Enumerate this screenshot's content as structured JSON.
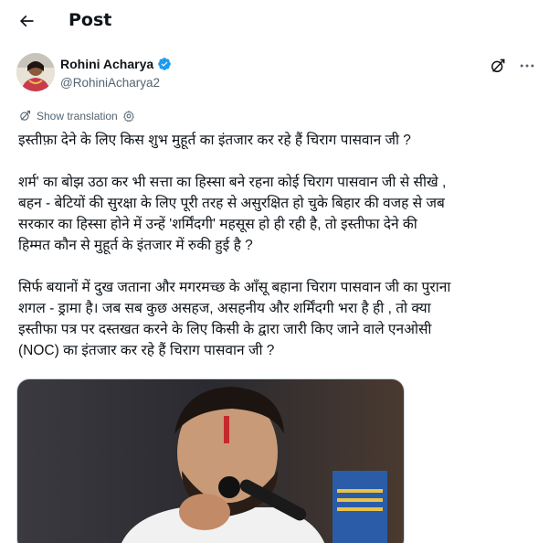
{
  "header": {
    "title": "Post",
    "back_icon": "arrow-left-icon"
  },
  "author": {
    "name": "Rohini Acharya",
    "handle": "@RohiniAcharya2",
    "verified_icon": "verified-badge-icon",
    "verified_color": "#1d9bf0"
  },
  "translate": {
    "label": "Show translation",
    "icon": "translate-icon",
    "settings_icon": "gear-icon"
  },
  "post": {
    "paragraph_1": [
      "इस्तीफ़ा देने के लिए किस शुभ मुहूर्त का इंतजार कर रहे हैं चिराग पासवान जी ?"
    ],
    "paragraph_2": [
      "शर्म' का बोझ उठा कर भी सत्ता का हिस्सा बने रहना कोई चिराग पासवान जी से सीखे ,",
      "बहन - बेटियों की सुरक्षा के लिए पूरी तरह से असुरक्षित हो चुके बिहार की वजह से जब",
      "सरकार का हिस्सा होने में उन्हें 'शर्मिंदगी' महसूस हो ही रही है, तो इस्तीफा देने की",
      "हिम्मत कौन से मुहूर्त के इंतजार में रुकी हुई है ?"
    ],
    "paragraph_3": [
      "सिर्फ बयानों में दुख जताना और मगरमच्छ के आँसू बहाना चिराग पासवान जी का पुराना",
      "शगल - ड्रामा है। जब सब कुछ असहज, असहनीय और शर्मिंदगी भरा है ही , तो क्या",
      "इस्तीफा पत्र पर दस्तखत करने के लिए किसी के द्वारा जारी किए जाने वाले एनओसी",
      "(NOC) का इंतजार कर रहे हैं चिराग पासवान जी ?"
    ]
  },
  "actions": {
    "grok_icon": "grok-icon",
    "more_icon": "more-horizontal-icon"
  },
  "media": {
    "description_icon": "photo"
  }
}
